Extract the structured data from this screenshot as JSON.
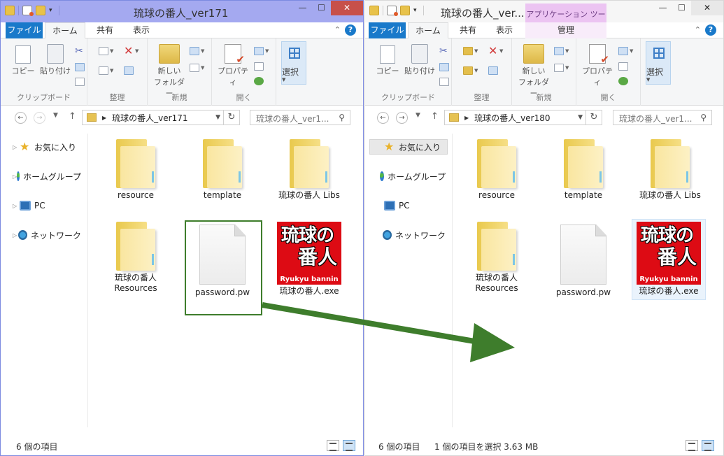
{
  "windows": {
    "left": {
      "title": "琉球の番人_ver171",
      "path": "琉球の番人_ver171",
      "search_placeholder": "琉球の番人_ver1...",
      "items": [
        {
          "label": "resource",
          "type": "folder"
        },
        {
          "label": "template",
          "type": "folder"
        },
        {
          "label": "琉球の番人 Libs",
          "type": "folder"
        },
        {
          "label": "琉球の番人\nResources",
          "type": "folder"
        },
        {
          "label": "password.pw",
          "type": "file"
        },
        {
          "label": "琉球の番人.exe",
          "type": "exe"
        }
      ],
      "status_count": "6 個の項目",
      "status_selection": ""
    },
    "right": {
      "title": "琉球の番人_ver...",
      "context_tab_title": "アプリケーション ツール",
      "path": "琉球の番人_ver180",
      "search_placeholder": "琉球の番人_ver1...",
      "items": [
        {
          "label": "resource",
          "type": "folder"
        },
        {
          "label": "template",
          "type": "folder"
        },
        {
          "label": "琉球の番人 Libs",
          "type": "folder"
        },
        {
          "label": "琉球の番人\nResources",
          "type": "folder"
        },
        {
          "label": "password.pw",
          "type": "file"
        },
        {
          "label": "琉球の番人.exe",
          "type": "exe"
        }
      ],
      "status_count": "6 個の項目",
      "status_selection": "1 個の項目を選択 3.63 MB"
    }
  },
  "tabs": {
    "file": "ファイル",
    "home": "ホーム",
    "share": "共有",
    "view": "表示",
    "manage": "管理"
  },
  "ribbon": {
    "copy": "コピー",
    "paste": "貼り付け",
    "clipboard_group": "クリップボード",
    "organize_group": "整理",
    "new_folder_line1": "新しい",
    "new_folder_line2": "フォルダー",
    "new_group": "新規",
    "properties": "プロパティ",
    "open_group": "開く",
    "select": "選択"
  },
  "nav": {
    "favorites": "お気に入り",
    "homegroup": "ホームグループ",
    "pc": "PC",
    "network": "ネットワーク"
  },
  "exe_icon": {
    "line1": "琉球の",
    "line2": "番人",
    "line3": "Ryukyu bannin"
  },
  "colors": {
    "left_titlebar": "#a4a9f0",
    "file_tab": "#1979ca",
    "arrow": "#3e7d2c",
    "exe_red": "#dd0b14"
  }
}
